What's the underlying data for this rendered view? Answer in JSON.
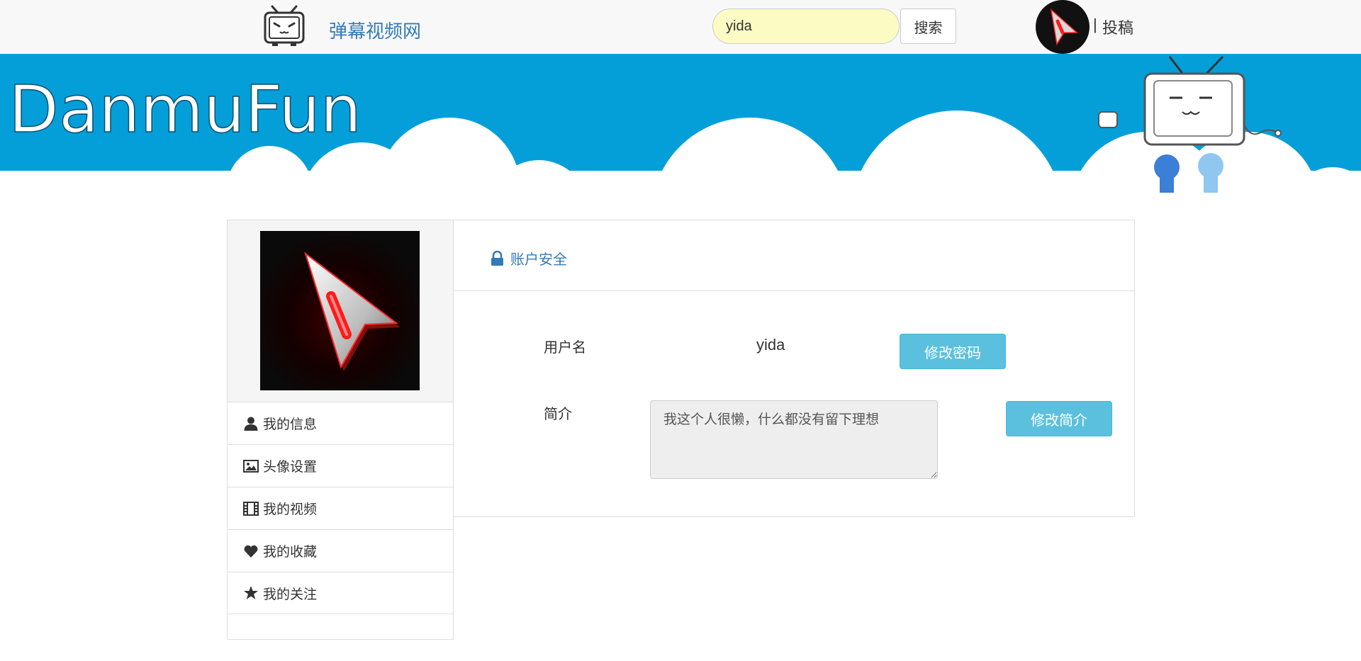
{
  "header": {
    "site_name": "弹幕视频网",
    "search": {
      "value": "yida"
    },
    "search_button": "搜索",
    "separator": "|",
    "upload_link": "投稿"
  },
  "banner": {
    "logo_text": "DanmuFun"
  },
  "sidebar": {
    "menu": [
      {
        "label": "我的信息",
        "icon": "user-icon"
      },
      {
        "label": "头像设置",
        "icon": "picture-icon"
      },
      {
        "label": "我的视频",
        "icon": "film-icon"
      },
      {
        "label": "我的收藏",
        "icon": "heart-icon"
      },
      {
        "label": "我的关注",
        "icon": "star-icon"
      }
    ]
  },
  "main": {
    "tab": {
      "label": "账户安全",
      "icon": "lock-icon"
    },
    "username_label": "用户名",
    "username_value": "yida",
    "change_password_button": "修改密码",
    "bio_label": "简介",
    "bio_value": "我这个人很懒，什么都没有留下理想",
    "change_bio_button": "修改简介"
  },
  "colors": {
    "accent_link": "#337ab7",
    "banner_blue": "#049fd9",
    "info_button": "#5bc0de",
    "search_bg": "#fbfbc3"
  }
}
